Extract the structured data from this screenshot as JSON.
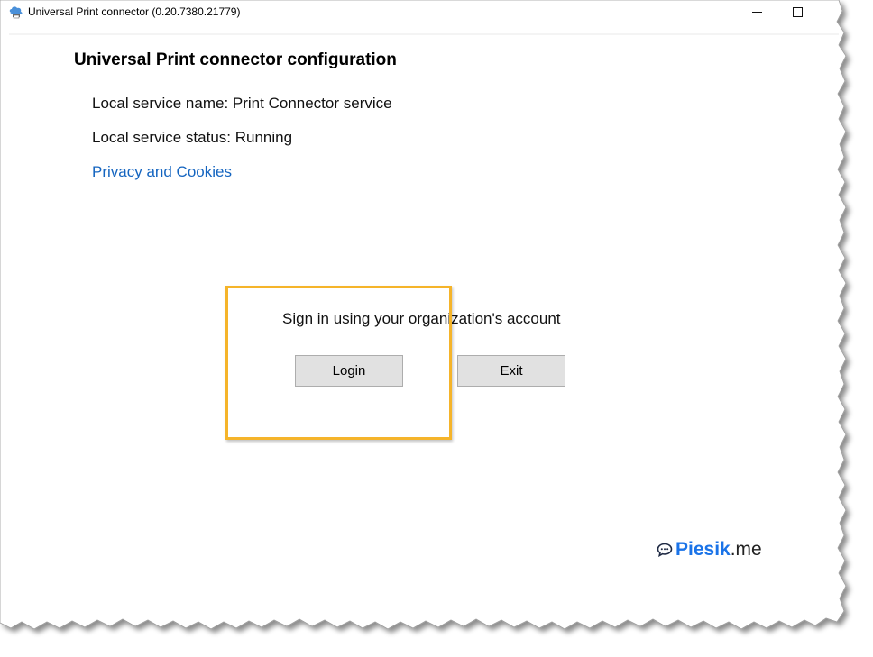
{
  "window": {
    "title": "Universal Print connector (0.20.7380.21779)",
    "controls": {
      "minimize_icon": "minimize-icon",
      "maximize_icon": "maximize-icon"
    }
  },
  "main": {
    "heading": "Universal Print connector configuration",
    "service_name_line": "Local service name: Print Connector service",
    "service_status_line": "Local service status: Running",
    "privacy_link": "Privacy and Cookies",
    "signin_prompt": "Sign in using your organization's account",
    "login_button": "Login",
    "exit_button": "Exit"
  },
  "watermark": {
    "brand": "Piesik",
    "tld": ".me",
    "icon": "chat-bubble-icon"
  },
  "colors": {
    "link": "#1565c0",
    "highlight": "#f5b42a",
    "button_bg": "#e1e1e1",
    "brand": "#1a73e8"
  }
}
